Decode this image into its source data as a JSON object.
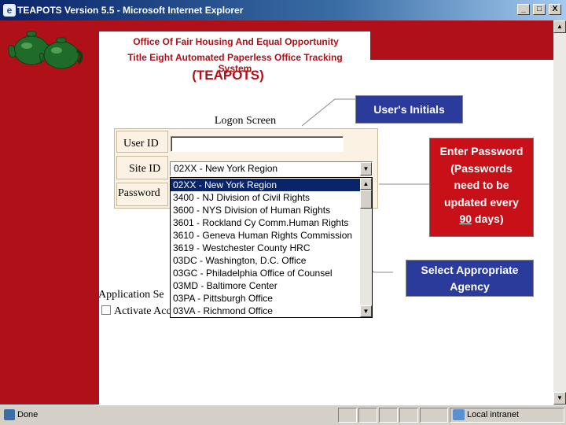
{
  "window": {
    "title": "TEAPOTS Version 5.5 - Microsoft Internet Explorer",
    "minimize": "_",
    "maximize": "□",
    "close": "X"
  },
  "header": {
    "line1": "Office Of Fair Housing And Equal Opportunity",
    "line2": "Title Eight Automated Paperless Office Tracking System",
    "acronym": "(TEAPOTS)"
  },
  "logon": {
    "title": "Logon Screen",
    "user_id_label": "User ID",
    "site_id_label": "Site ID",
    "password_label": "Password",
    "user_id_value": "",
    "site_selected": "02XX - New York Region"
  },
  "site_options": [
    "02XX - New York Region",
    "3400 - NJ Division of Civil Rights",
    "3600 - NYS Division of Human Rights",
    "3601 - Rockland Cy Comm.Human Rights",
    "3610 - Geneva Human Rights Commission",
    "3619 - Westchester County HRC",
    "03DC - Washington, D.C. Office",
    "03GC - Philadelphia Office of Counsel",
    "03MD - Baltimore Center",
    "03PA - Pittsburgh Office",
    "03VA - Richmond Office"
  ],
  "below_form": {
    "application_security": "Application Se",
    "activate": "Activate Acc"
  },
  "callouts": {
    "initials": "User's Initials",
    "password_l1": "Enter Password",
    "password_l2": "(Passwords",
    "password_l3": "need to be",
    "password_l4": "updated every",
    "password_90": "90",
    "password_days": " days)",
    "agency_l1": "Select Appropriate",
    "agency_l2": "Agency"
  },
  "status": {
    "text": "Done",
    "zone": "Local intranet"
  },
  "colors": {
    "brand_red": "#b01018",
    "callout_blue": "#2a3b9c",
    "callout_red": "#c81018",
    "selection": "#0a246a"
  }
}
